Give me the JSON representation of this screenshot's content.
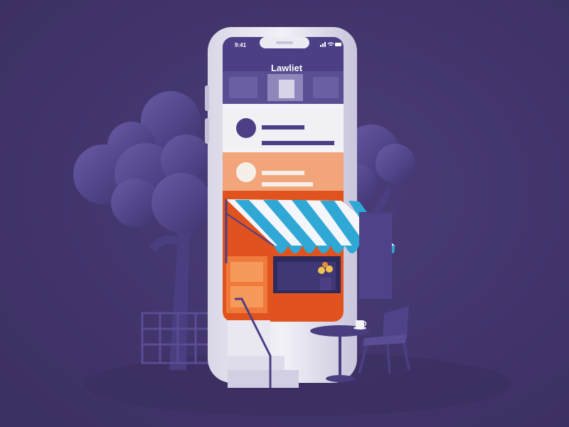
{
  "phone": {
    "app_title": "Lawliet",
    "status_time": "9:41"
  },
  "colors": {
    "background": "#43356b",
    "phone_body": "#ecebf3",
    "header_purple": "#4c3f86",
    "card_white": "#f1f1f5",
    "card_peach": "#f2a57b",
    "awning_blue": "#2fa8d6",
    "awning_white": "#f4f6fb",
    "shop_orange": "#e0521e",
    "tree_purple": "#5b4c94"
  },
  "icons": [
    "signal-icon",
    "wifi-icon",
    "battery-icon"
  ]
}
